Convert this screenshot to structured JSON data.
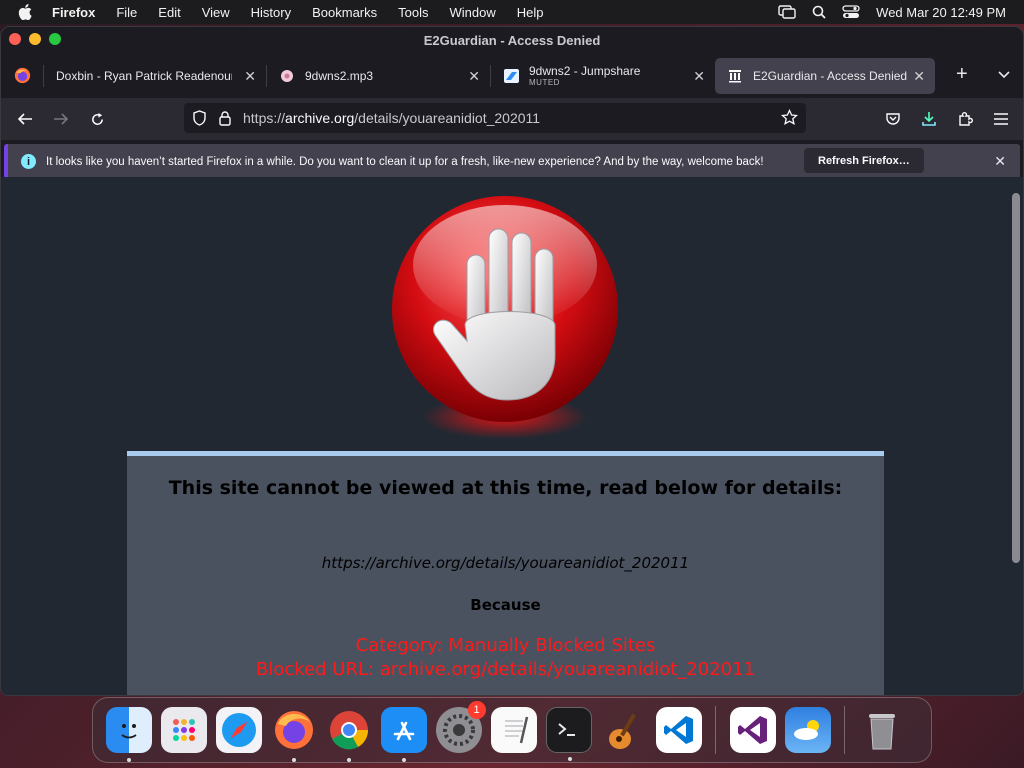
{
  "menubar": {
    "app_name": "Firefox",
    "items": [
      "File",
      "Edit",
      "View",
      "History",
      "Bookmarks",
      "Tools",
      "Window",
      "Help"
    ],
    "clock": "Wed Mar 20  12:49 PM"
  },
  "window": {
    "title": "E2Guardian - Access Denied"
  },
  "tabs": [
    {
      "title": "Doxbin - Ryan Patrick Readenour - ...",
      "subtitle": "",
      "icon": "firefox-icon"
    },
    {
      "title": "9dwns2.mp3",
      "subtitle": "",
      "icon": "audio-icon"
    },
    {
      "title": "9dwns2 - Jumpshare",
      "subtitle": "MUTED",
      "icon": "jumpshare-icon"
    },
    {
      "title": "E2Guardian - Access Denied",
      "subtitle": "",
      "icon": "archive-icon"
    }
  ],
  "navbar": {
    "url_prefix": "https://",
    "url_domain": "archive.org",
    "url_path": "/details/youareanidiot_202011"
  },
  "notification": {
    "message": "It looks like you haven’t started Firefox in a while. Do you want to clean it up for a fresh, like-new experience? And by the way, welcome back!",
    "button": "Refresh Firefox…"
  },
  "page": {
    "headline": "This site cannot be viewed at this time, read below for details:",
    "blocked_url": "https://archive.org/details/youareanidiot_202011",
    "because": "Because",
    "category": "Category: Manually Blocked Sites",
    "blocked_line": "Blocked URL: archive.org/details/youareanidiot_202011"
  },
  "dock": {
    "apps": [
      "Finder",
      "Launchpad",
      "Safari",
      "Firefox",
      "Chrome",
      "App Store",
      "System Settings",
      "TextEdit",
      "Terminal",
      "GarageBand",
      "VS Code",
      "Visual Studio",
      "Weather",
      "Trash"
    ],
    "system_settings_badge": "1"
  },
  "colors": {
    "accent_notify": "#7542e5",
    "blocked_red": "#ff1a1a",
    "panel_top": "#a9cbed"
  }
}
